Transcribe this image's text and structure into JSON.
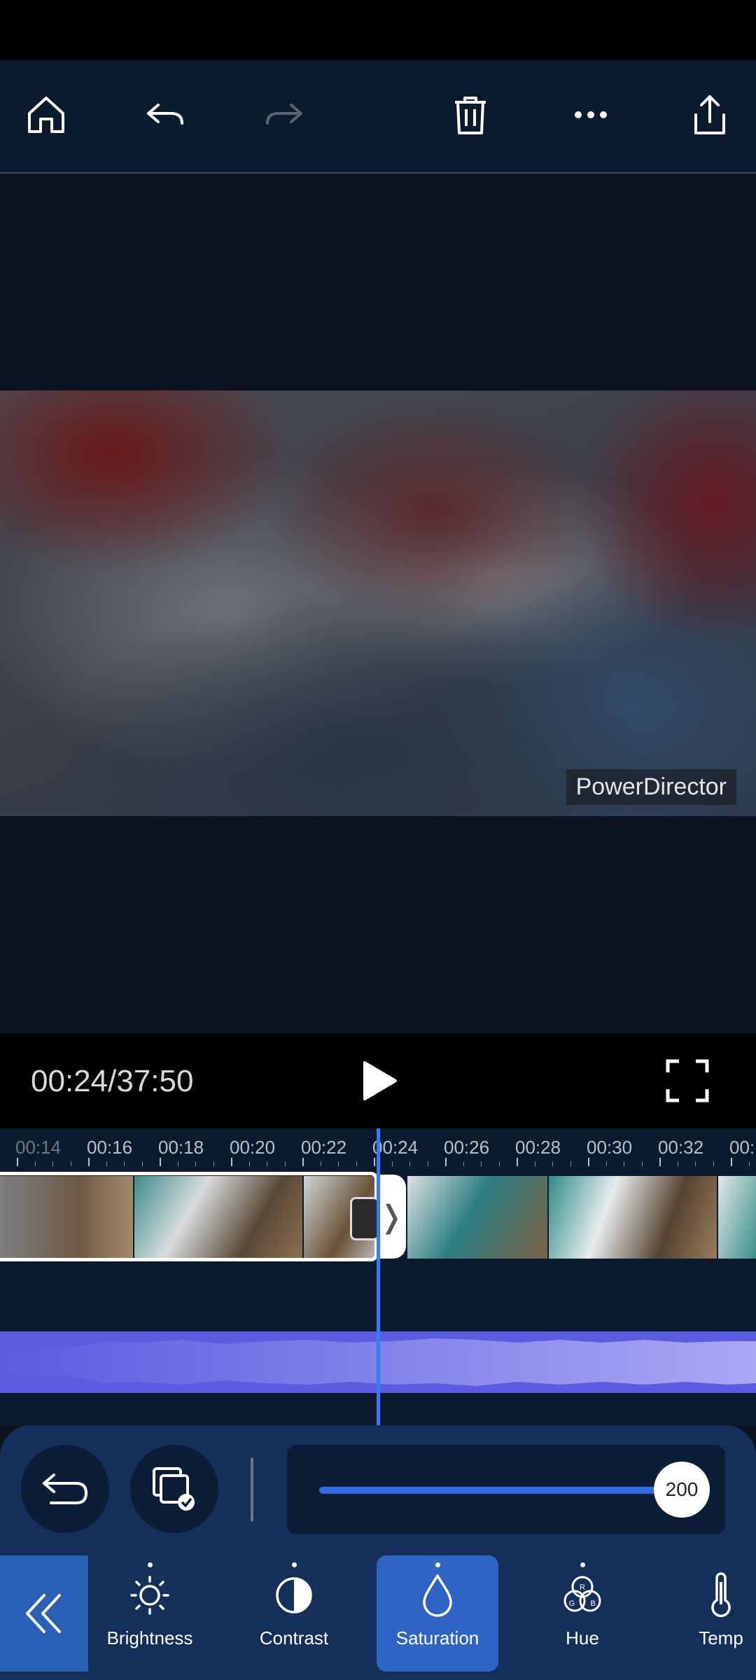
{
  "toolbar": {
    "buttons": [
      "home-icon",
      "undo-icon",
      "redo-icon",
      "delete-icon",
      "more-icon",
      "share-icon"
    ]
  },
  "preview": {
    "watermark": "PowerDirector"
  },
  "playback": {
    "time": "00:24/37:50"
  },
  "timeline": {
    "ticks": [
      "00:14",
      "00:16",
      "00:18",
      "00:20",
      "00:22",
      "00:24",
      "00:26",
      "00:28",
      "00:30",
      "00:32",
      "00:"
    ]
  },
  "adjust": {
    "slider_value": "200",
    "slider_fraction": 1.0
  },
  "tools": {
    "items": [
      {
        "label": "Brightness",
        "icon": "sun-icon"
      },
      {
        "label": "Contrast",
        "icon": "contrast-icon"
      },
      {
        "label": "Saturation",
        "icon": "drop-icon",
        "selected": true
      },
      {
        "label": "Hue",
        "icon": "rgb-icon"
      },
      {
        "label": "Temp",
        "icon": "thermometer-icon"
      }
    ]
  },
  "colors": {
    "accent": "#2f64c4",
    "playhead": "#3a7bf0",
    "audio": "#5b5ce0",
    "toolbar_bg": "#0c1a2e"
  }
}
